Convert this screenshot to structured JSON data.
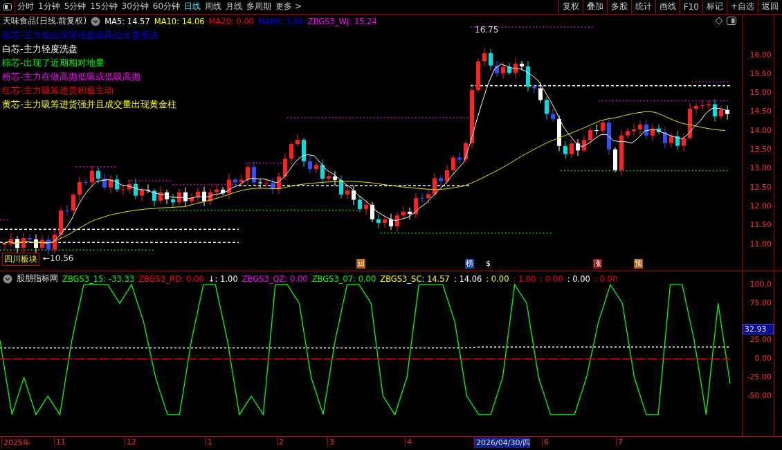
{
  "toolbar": {
    "periods": [
      {
        "label": "分时",
        "selected": false
      },
      {
        "label": "1分钟",
        "selected": false
      },
      {
        "label": "5分钟",
        "selected": false
      },
      {
        "label": "15分钟",
        "selected": false
      },
      {
        "label": "30分钟",
        "selected": false
      },
      {
        "label": "60分钟",
        "selected": false
      },
      {
        "label": "日线",
        "selected": true
      },
      {
        "label": "周线",
        "selected": false
      },
      {
        "label": "月线",
        "selected": false
      },
      {
        "label": "多周期",
        "selected": false
      },
      {
        "label": "更多 >",
        "selected": false
      }
    ],
    "actions": [
      "复权",
      "叠加",
      "多股",
      "统计",
      "画线",
      "F10",
      "标记",
      "+自选",
      "返回"
    ]
  },
  "main_chart": {
    "title": "天味食品(日线.前复权)",
    "indicators": [
      {
        "text": "MA5: 14.57",
        "color": "#ffffff"
      },
      {
        "text": "MA10: 14.06",
        "color": "#ffff00"
      },
      {
        "text": "MA20: 0.00",
        "color": "#ff0000"
      },
      {
        "text": "MA60: 1.00",
        "color": "#0000ff"
      },
      {
        "text": "ZBGS3_WJ: 15.24",
        "color": "#ff00ff"
      }
    ],
    "legend": [
      {
        "text": "蓝芯-主力低位深度洗盘或高位出货坚决",
        "color": "#0000ff"
      },
      {
        "text": "白芯-主力轻度洗盘",
        "color": "#ffffff"
      },
      {
        "text": "棕芯-出现了近期相对地量",
        "color": "#00ff00"
      },
      {
        "text": "粉芯-主力在做高抛低吸或低吸高抛",
        "color": "#ff00ff"
      },
      {
        "text": "红芯-主力吸筹进货积极主动",
        "color": "#ff0000"
      },
      {
        "text": "黄芯-主力吸筹进货强并且成交量出现黄金柱",
        "color": "#ffff00"
      }
    ],
    "high_label": "16.75",
    "sector_tag": "四川板块",
    "low_label": "←10.56",
    "markers": [
      {
        "text": "回",
        "color": "#b05a10"
      },
      {
        "text": "榜",
        "color": "#2040a0"
      },
      {
        "text": "$",
        "color": "#000000"
      },
      {
        "text": "涨",
        "color": "#8a1010"
      },
      {
        "text": "预",
        "color": "#b05a10"
      }
    ],
    "price_ticks": [
      "16.00",
      "15.50",
      "15.00",
      "14.50",
      "14.00",
      "13.50",
      "13.00",
      "12.50",
      "12.00",
      "11.50",
      "11.00"
    ]
  },
  "indicator_panel": {
    "title": "股朋指标网",
    "legend": [
      {
        "text": "ZBGS3_15: -33.33",
        "color": "#00ff00"
      },
      {
        "text": "ZBGS3_RD: 0.00",
        "color": "#ff0000"
      },
      {
        "text": "↓: 1.00",
        "color": "#ffffff"
      },
      {
        "text": "ZBGS3_QZ: 0.00",
        "color": "#ff00ff"
      },
      {
        "text": "ZBGS3_07: 0.00",
        "color": "#00ff00"
      },
      {
        "text": "ZBGS3_SC: 14.57",
        "color": "#ffff00"
      },
      {
        "text": ": 14.06",
        "color": "#ffffff"
      },
      {
        "text": ": 0.00",
        "color": "#ffff00"
      },
      {
        "text": ": 1.00",
        "color": "#ff0000"
      },
      {
        "text": ": 0.00",
        "color": "#ff0000"
      },
      {
        "text": ": 0.00",
        "color": "#ffffff"
      },
      {
        "text": ": 0.00",
        "color": "#ff0000"
      }
    ],
    "current_value": "32.93",
    "chart_data": {
      "type": "line",
      "ylim": [
        -104,
        117
      ],
      "yticks": [
        {
          "value": 100,
          "label": "100.0"
        },
        {
          "value": 75,
          "label": "75.00"
        },
        {
          "value": 25,
          "label": "25.00"
        },
        {
          "value": 0,
          "label": "0.00"
        },
        {
          "value": -25,
          "label": "-25.00"
        },
        {
          "value": -50,
          "label": "-50.00"
        }
      ],
      "series": [
        {
          "color": "#00ff00",
          "values": [
            25,
            -75,
            -25,
            -75,
            -50,
            -75,
            25,
            100,
            100,
            100,
            75,
            100,
            50,
            -25,
            -75,
            -75,
            25,
            100,
            100,
            25,
            -75,
            -50,
            -75,
            100,
            100,
            75,
            -25,
            -75,
            25,
            100,
            100,
            75,
            -50,
            -75,
            -25,
            100,
            100,
            100,
            50,
            -50,
            -75,
            -75,
            -25,
            100,
            75,
            -25,
            -75,
            -75,
            -75,
            -25,
            50,
            100,
            75,
            -25,
            -75,
            -75,
            100,
            100,
            25,
            -75,
            75,
            -33
          ]
        },
        {
          "color": "#ff0000",
          "line_style": "dashed",
          "values": [
            0,
            0,
            0,
            0,
            0,
            0,
            0,
            0,
            0,
            0,
            0,
            0,
            0,
            0,
            0,
            0,
            0,
            0,
            0,
            0,
            0,
            0,
            0,
            0,
            0,
            0,
            0,
            0,
            0,
            0,
            0,
            0,
            0,
            0,
            0,
            0,
            0,
            0,
            0,
            0,
            0,
            0,
            0,
            0,
            0,
            0,
            0,
            0,
            0,
            0,
            0,
            0,
            0,
            0,
            0,
            0,
            0,
            0,
            0,
            0,
            0,
            0
          ]
        },
        {
          "color": "#ffffff",
          "line_style": "dotted",
          "values": [
            15,
            15,
            15,
            15,
            15,
            15,
            15,
            15,
            15,
            15,
            15,
            15,
            15,
            15,
            15,
            15,
            15,
            15,
            15,
            15,
            15,
            15,
            15,
            15,
            15,
            15,
            15,
            15,
            15,
            15,
            15,
            15,
            15,
            15,
            15,
            15,
            15,
            15,
            15,
            15,
            16,
            16,
            16,
            16,
            16,
            16,
            16,
            16,
            16,
            16,
            16,
            16,
            16,
            16,
            16,
            16,
            16,
            16,
            16,
            16,
            16,
            16
          ]
        }
      ]
    }
  },
  "date_axis": [
    {
      "label": "2025年",
      "selected": false
    },
    {
      "label": "11",
      "selected": false
    },
    {
      "label": "12",
      "selected": false
    },
    {
      "label": "1",
      "selected": false
    },
    {
      "label": "2",
      "selected": false
    },
    {
      "label": "3",
      "selected": false
    },
    {
      "label": "4",
      "selected": false
    },
    {
      "label": "2026/04/30/四",
      "selected": true
    },
    {
      "label": "6",
      "selected": false
    },
    {
      "label": "7",
      "selected": false
    }
  ]
}
